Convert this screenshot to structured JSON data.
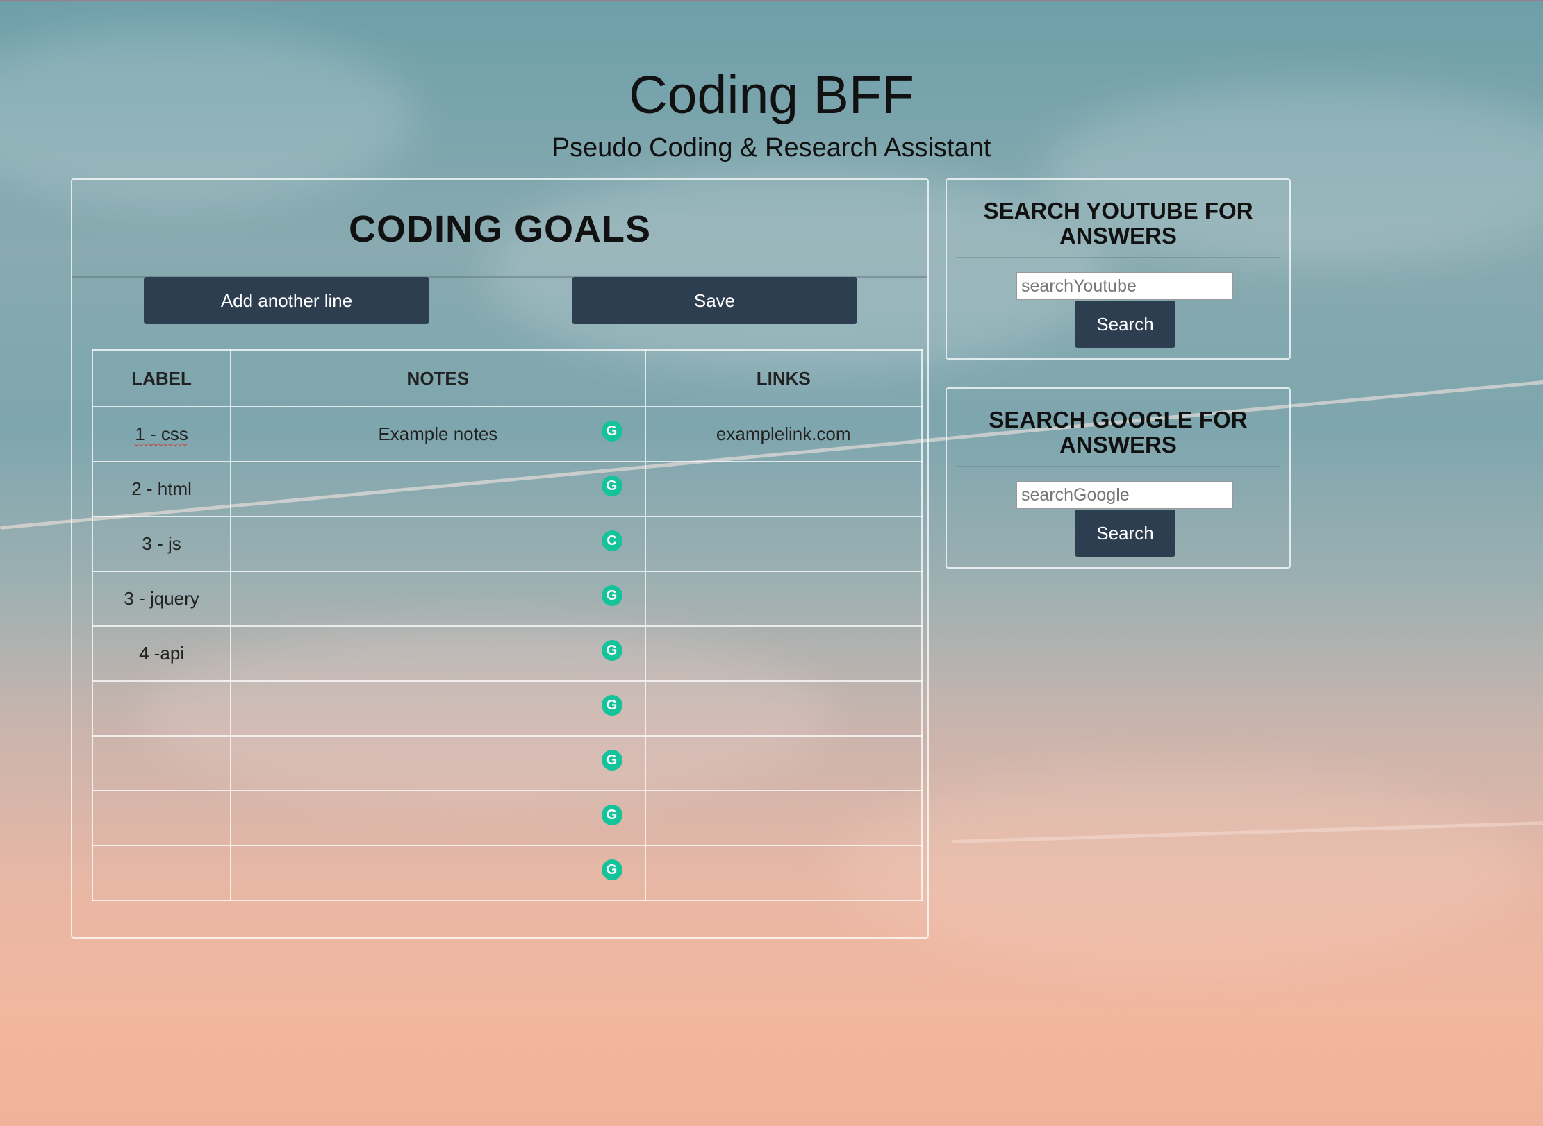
{
  "header": {
    "title": "Coding BFF",
    "subtitle": "Pseudo Coding & Research Assistant"
  },
  "goals": {
    "title": "CODING GOALS",
    "add_button": "Add another line",
    "save_button": "Save",
    "columns": [
      "LABEL",
      "NOTES",
      "LINKS"
    ],
    "rows": [
      {
        "label": "1 - css",
        "notes": "Example notes",
        "links": "examplelink.com"
      },
      {
        "label": "2 - html",
        "notes": "",
        "links": ""
      },
      {
        "label": "3 - js",
        "notes": "",
        "links": ""
      },
      {
        "label": "3 - jquery",
        "notes": "",
        "links": ""
      },
      {
        "label": "4 -api",
        "notes": "",
        "links": ""
      },
      {
        "label": "",
        "notes": "",
        "links": ""
      },
      {
        "label": "",
        "notes": "",
        "links": ""
      },
      {
        "label": "",
        "notes": "",
        "links": ""
      },
      {
        "label": "",
        "notes": "",
        "links": ""
      }
    ],
    "row_icon": "grammarly-icon"
  },
  "youtube": {
    "title": "SEARCH YOUTUBE FOR ANSWERS",
    "placeholder": "searchYoutube",
    "button": "Search"
  },
  "google": {
    "title": "SEARCH GOOGLE FOR ANSWERS",
    "placeholder": "searchGoogle",
    "button": "Search"
  },
  "colors": {
    "button_bg": "#2c3e50",
    "grammarly": "#15c39a"
  }
}
